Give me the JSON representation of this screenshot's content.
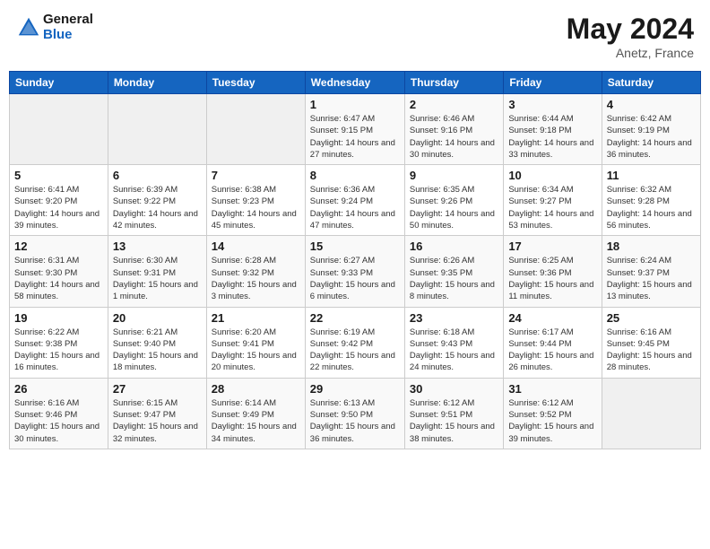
{
  "header": {
    "logo_line1": "General",
    "logo_line2": "Blue",
    "month_year": "May 2024",
    "location": "Anetz, France"
  },
  "weekdays": [
    "Sunday",
    "Monday",
    "Tuesday",
    "Wednesday",
    "Thursday",
    "Friday",
    "Saturday"
  ],
  "weeks": [
    [
      {
        "day": "",
        "sunrise": "",
        "sunset": "",
        "daylight": ""
      },
      {
        "day": "",
        "sunrise": "",
        "sunset": "",
        "daylight": ""
      },
      {
        "day": "",
        "sunrise": "",
        "sunset": "",
        "daylight": ""
      },
      {
        "day": "1",
        "sunrise": "Sunrise: 6:47 AM",
        "sunset": "Sunset: 9:15 PM",
        "daylight": "Daylight: 14 hours and 27 minutes."
      },
      {
        "day": "2",
        "sunrise": "Sunrise: 6:46 AM",
        "sunset": "Sunset: 9:16 PM",
        "daylight": "Daylight: 14 hours and 30 minutes."
      },
      {
        "day": "3",
        "sunrise": "Sunrise: 6:44 AM",
        "sunset": "Sunset: 9:18 PM",
        "daylight": "Daylight: 14 hours and 33 minutes."
      },
      {
        "day": "4",
        "sunrise": "Sunrise: 6:42 AM",
        "sunset": "Sunset: 9:19 PM",
        "daylight": "Daylight: 14 hours and 36 minutes."
      }
    ],
    [
      {
        "day": "5",
        "sunrise": "Sunrise: 6:41 AM",
        "sunset": "Sunset: 9:20 PM",
        "daylight": "Daylight: 14 hours and 39 minutes."
      },
      {
        "day": "6",
        "sunrise": "Sunrise: 6:39 AM",
        "sunset": "Sunset: 9:22 PM",
        "daylight": "Daylight: 14 hours and 42 minutes."
      },
      {
        "day": "7",
        "sunrise": "Sunrise: 6:38 AM",
        "sunset": "Sunset: 9:23 PM",
        "daylight": "Daylight: 14 hours and 45 minutes."
      },
      {
        "day": "8",
        "sunrise": "Sunrise: 6:36 AM",
        "sunset": "Sunset: 9:24 PM",
        "daylight": "Daylight: 14 hours and 47 minutes."
      },
      {
        "day": "9",
        "sunrise": "Sunrise: 6:35 AM",
        "sunset": "Sunset: 9:26 PM",
        "daylight": "Daylight: 14 hours and 50 minutes."
      },
      {
        "day": "10",
        "sunrise": "Sunrise: 6:34 AM",
        "sunset": "Sunset: 9:27 PM",
        "daylight": "Daylight: 14 hours and 53 minutes."
      },
      {
        "day": "11",
        "sunrise": "Sunrise: 6:32 AM",
        "sunset": "Sunset: 9:28 PM",
        "daylight": "Daylight: 14 hours and 56 minutes."
      }
    ],
    [
      {
        "day": "12",
        "sunrise": "Sunrise: 6:31 AM",
        "sunset": "Sunset: 9:30 PM",
        "daylight": "Daylight: 14 hours and 58 minutes."
      },
      {
        "day": "13",
        "sunrise": "Sunrise: 6:30 AM",
        "sunset": "Sunset: 9:31 PM",
        "daylight": "Daylight: 15 hours and 1 minute."
      },
      {
        "day": "14",
        "sunrise": "Sunrise: 6:28 AM",
        "sunset": "Sunset: 9:32 PM",
        "daylight": "Daylight: 15 hours and 3 minutes."
      },
      {
        "day": "15",
        "sunrise": "Sunrise: 6:27 AM",
        "sunset": "Sunset: 9:33 PM",
        "daylight": "Daylight: 15 hours and 6 minutes."
      },
      {
        "day": "16",
        "sunrise": "Sunrise: 6:26 AM",
        "sunset": "Sunset: 9:35 PM",
        "daylight": "Daylight: 15 hours and 8 minutes."
      },
      {
        "day": "17",
        "sunrise": "Sunrise: 6:25 AM",
        "sunset": "Sunset: 9:36 PM",
        "daylight": "Daylight: 15 hours and 11 minutes."
      },
      {
        "day": "18",
        "sunrise": "Sunrise: 6:24 AM",
        "sunset": "Sunset: 9:37 PM",
        "daylight": "Daylight: 15 hours and 13 minutes."
      }
    ],
    [
      {
        "day": "19",
        "sunrise": "Sunrise: 6:22 AM",
        "sunset": "Sunset: 9:38 PM",
        "daylight": "Daylight: 15 hours and 16 minutes."
      },
      {
        "day": "20",
        "sunrise": "Sunrise: 6:21 AM",
        "sunset": "Sunset: 9:40 PM",
        "daylight": "Daylight: 15 hours and 18 minutes."
      },
      {
        "day": "21",
        "sunrise": "Sunrise: 6:20 AM",
        "sunset": "Sunset: 9:41 PM",
        "daylight": "Daylight: 15 hours and 20 minutes."
      },
      {
        "day": "22",
        "sunrise": "Sunrise: 6:19 AM",
        "sunset": "Sunset: 9:42 PM",
        "daylight": "Daylight: 15 hours and 22 minutes."
      },
      {
        "day": "23",
        "sunrise": "Sunrise: 6:18 AM",
        "sunset": "Sunset: 9:43 PM",
        "daylight": "Daylight: 15 hours and 24 minutes."
      },
      {
        "day": "24",
        "sunrise": "Sunrise: 6:17 AM",
        "sunset": "Sunset: 9:44 PM",
        "daylight": "Daylight: 15 hours and 26 minutes."
      },
      {
        "day": "25",
        "sunrise": "Sunrise: 6:16 AM",
        "sunset": "Sunset: 9:45 PM",
        "daylight": "Daylight: 15 hours and 28 minutes."
      }
    ],
    [
      {
        "day": "26",
        "sunrise": "Sunrise: 6:16 AM",
        "sunset": "Sunset: 9:46 PM",
        "daylight": "Daylight: 15 hours and 30 minutes."
      },
      {
        "day": "27",
        "sunrise": "Sunrise: 6:15 AM",
        "sunset": "Sunset: 9:47 PM",
        "daylight": "Daylight: 15 hours and 32 minutes."
      },
      {
        "day": "28",
        "sunrise": "Sunrise: 6:14 AM",
        "sunset": "Sunset: 9:49 PM",
        "daylight": "Daylight: 15 hours and 34 minutes."
      },
      {
        "day": "29",
        "sunrise": "Sunrise: 6:13 AM",
        "sunset": "Sunset: 9:50 PM",
        "daylight": "Daylight: 15 hours and 36 minutes."
      },
      {
        "day": "30",
        "sunrise": "Sunrise: 6:12 AM",
        "sunset": "Sunset: 9:51 PM",
        "daylight": "Daylight: 15 hours and 38 minutes."
      },
      {
        "day": "31",
        "sunrise": "Sunrise: 6:12 AM",
        "sunset": "Sunset: 9:52 PM",
        "daylight": "Daylight: 15 hours and 39 minutes."
      },
      {
        "day": "",
        "sunrise": "",
        "sunset": "",
        "daylight": ""
      }
    ]
  ]
}
